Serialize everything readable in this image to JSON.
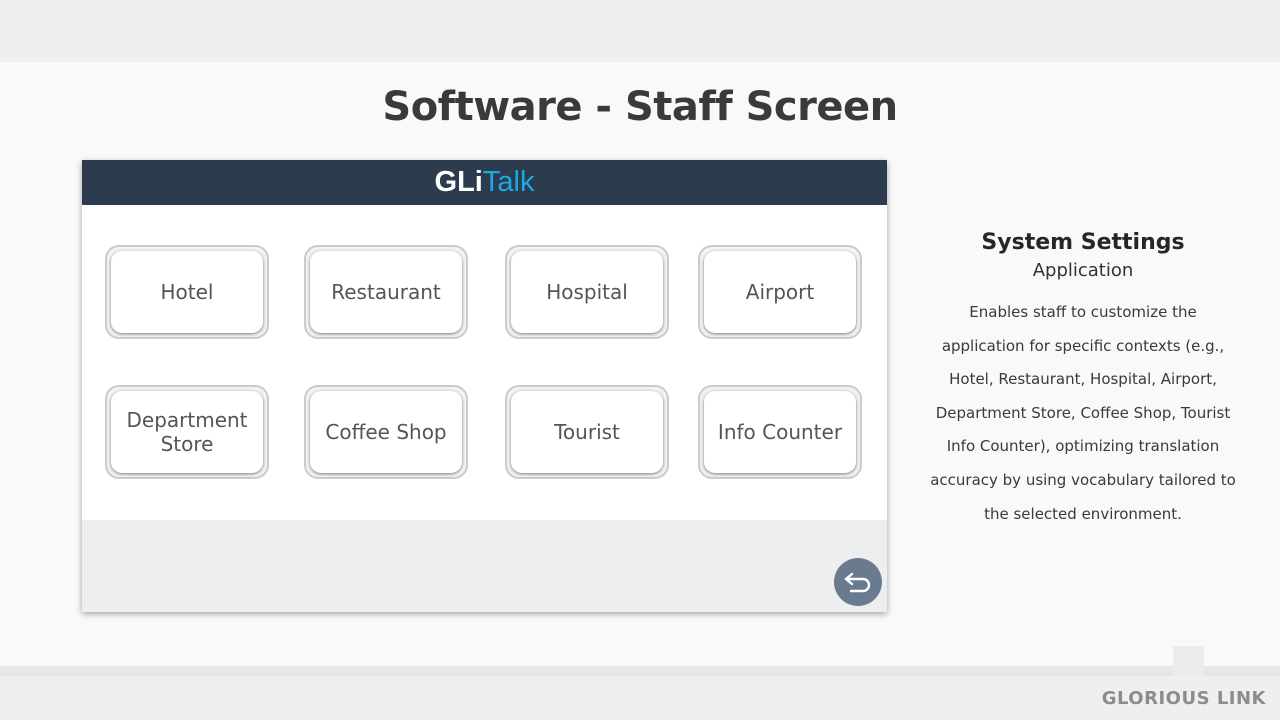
{
  "slide": {
    "title": "Software - Staff Screen"
  },
  "device": {
    "brand_part1": "GLi",
    "brand_part2": "Talk",
    "brand_color_1": "#ffffff",
    "brand_color_2": "#1ba9e6",
    "header_color": "#2c3b4e",
    "buttons": [
      {
        "label": "Hotel"
      },
      {
        "label": "Restaurant"
      },
      {
        "label": "Hospital"
      },
      {
        "label": "Airport"
      },
      {
        "label": "Department Store"
      },
      {
        "label": "Coffee Shop"
      },
      {
        "label": "Tourist"
      },
      {
        "label": "Info Counter"
      }
    ],
    "back_icon": "return-arrow-icon"
  },
  "description": {
    "title": "System Settings",
    "subtitle": "Application",
    "body": "Enables staff to customize the application for specific contexts (e.g., Hotel, Restaurant, Hospital, Airport, Department Store, Coffee Shop, Tourist Info Counter), optimizing translation accuracy by using vocabulary tailored to the selected environment."
  },
  "footer": {
    "logo_text": "GLORIOUS LINK"
  }
}
